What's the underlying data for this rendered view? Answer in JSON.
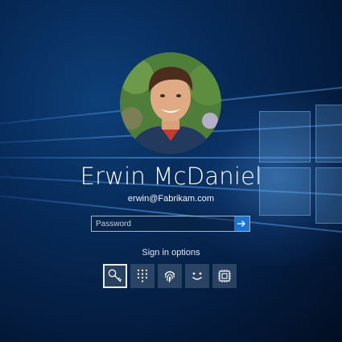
{
  "user": {
    "name": "Erwin McDaniel",
    "email": "erwin@Fabrikam.com"
  },
  "password": {
    "placeholder": "Password",
    "value": ""
  },
  "sign_in_options": {
    "label": "Sign in options",
    "selected": "password-key",
    "options": [
      {
        "id": "password-key",
        "icon": "key-icon"
      },
      {
        "id": "pin",
        "icon": "pin-keypad-icon"
      },
      {
        "id": "fingerprint",
        "icon": "fingerprint-icon"
      },
      {
        "id": "face",
        "icon": "smiley-face-icon"
      },
      {
        "id": "security-key",
        "icon": "security-key-chip-icon"
      }
    ]
  },
  "colors": {
    "accent": "#1a73d6",
    "background": "#072a58"
  }
}
